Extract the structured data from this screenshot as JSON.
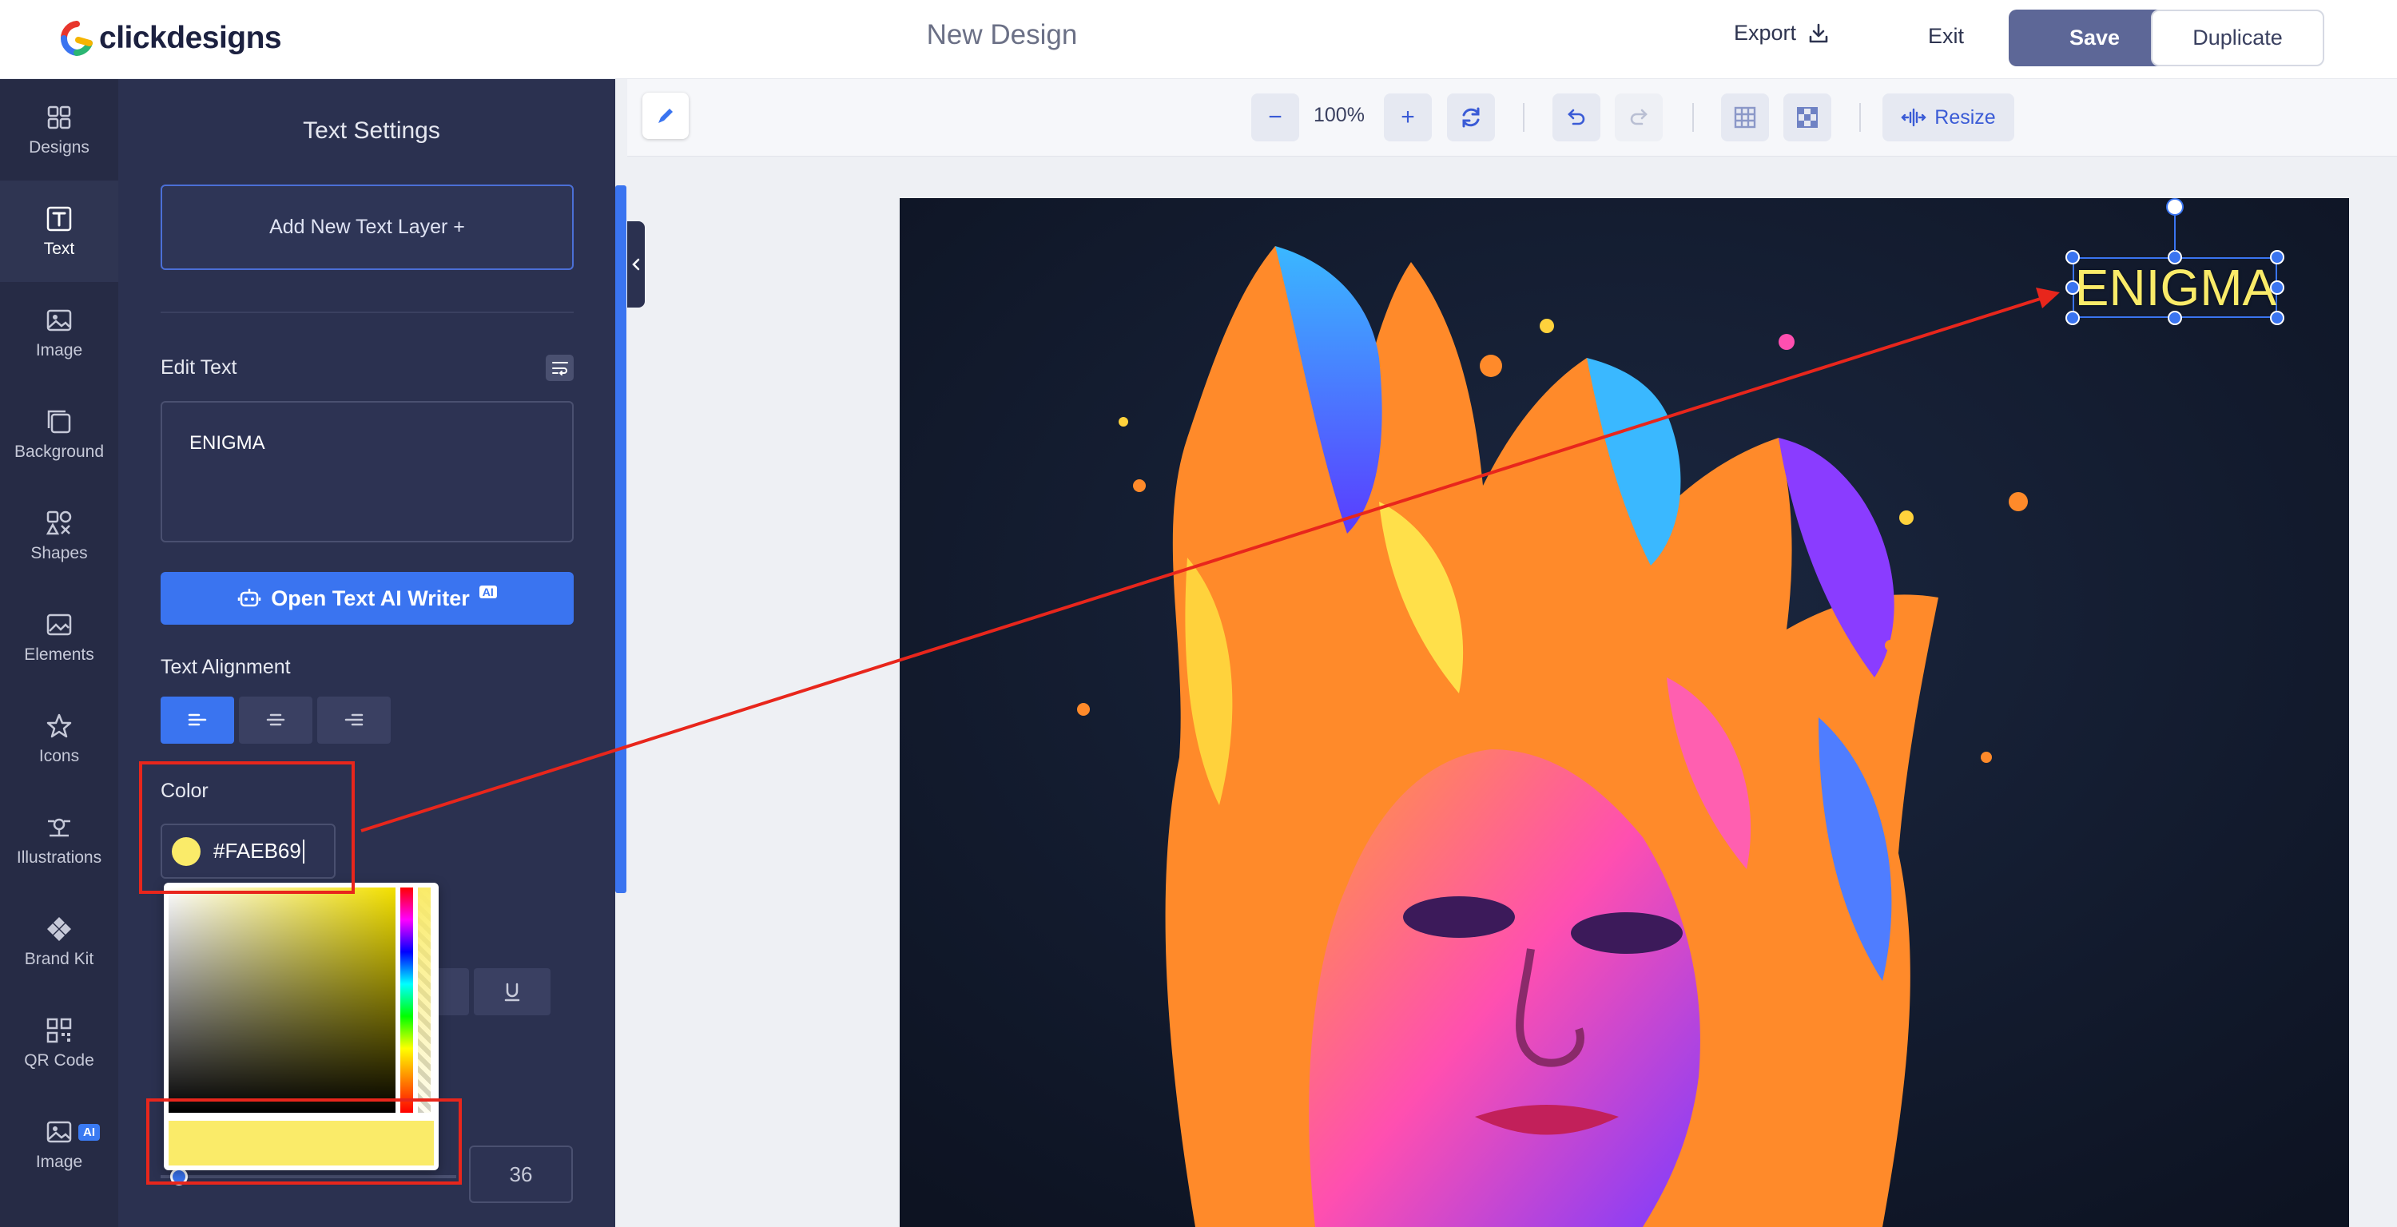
{
  "app": {
    "brand": "clickdesigns",
    "document_title": "New Design"
  },
  "topbar": {
    "export_label": "Export",
    "exit_label": "Exit",
    "save_label": "Save",
    "duplicate_label": "Duplicate"
  },
  "rail": {
    "items": [
      {
        "label": "Designs",
        "icon": "designs-icon"
      },
      {
        "label": "Text",
        "icon": "text-icon",
        "active": true
      },
      {
        "label": "Image",
        "icon": "image-icon"
      },
      {
        "label": "Background",
        "icon": "background-icon"
      },
      {
        "label": "Shapes",
        "icon": "shapes-icon"
      },
      {
        "label": "Elements",
        "icon": "elements-icon"
      },
      {
        "label": "Icons",
        "icon": "star-icon"
      },
      {
        "label": "Illustrations",
        "icon": "illustrations-icon"
      },
      {
        "label": "Brand Kit",
        "icon": "brand-kit-icon"
      },
      {
        "label": "QR Code",
        "icon": "qr-code-icon"
      },
      {
        "label": "Image",
        "icon": "ai-image-icon",
        "badge": "AI"
      }
    ]
  },
  "panel": {
    "title": "Text Settings",
    "add_layer_label": "Add New Text Layer +",
    "edit_text_label": "Edit Text",
    "edit_text_value": "ENIGMA",
    "ai_writer_label": "Open Text AI Writer",
    "ai_writer_badge": "AI",
    "alignment_label": "Text Alignment",
    "alignment_options": [
      "left",
      "center",
      "right"
    ],
    "alignment_selected": "left",
    "color_label": "Color",
    "color_value": "#FAEB69",
    "font_size_value": "36"
  },
  "toolbar": {
    "zoom_minus": "−",
    "zoom_level": "100%",
    "zoom_plus": "+",
    "resize_label": "Resize"
  },
  "canvas": {
    "text_layer": "ENIGMA",
    "text_color": "#FAEB69"
  },
  "colors": {
    "accent": "#3A74F0",
    "save_button": "#5D6797",
    "panel_bg": "#2B3150",
    "rail_bg": "#262B45",
    "highlight": "#E8261C"
  }
}
